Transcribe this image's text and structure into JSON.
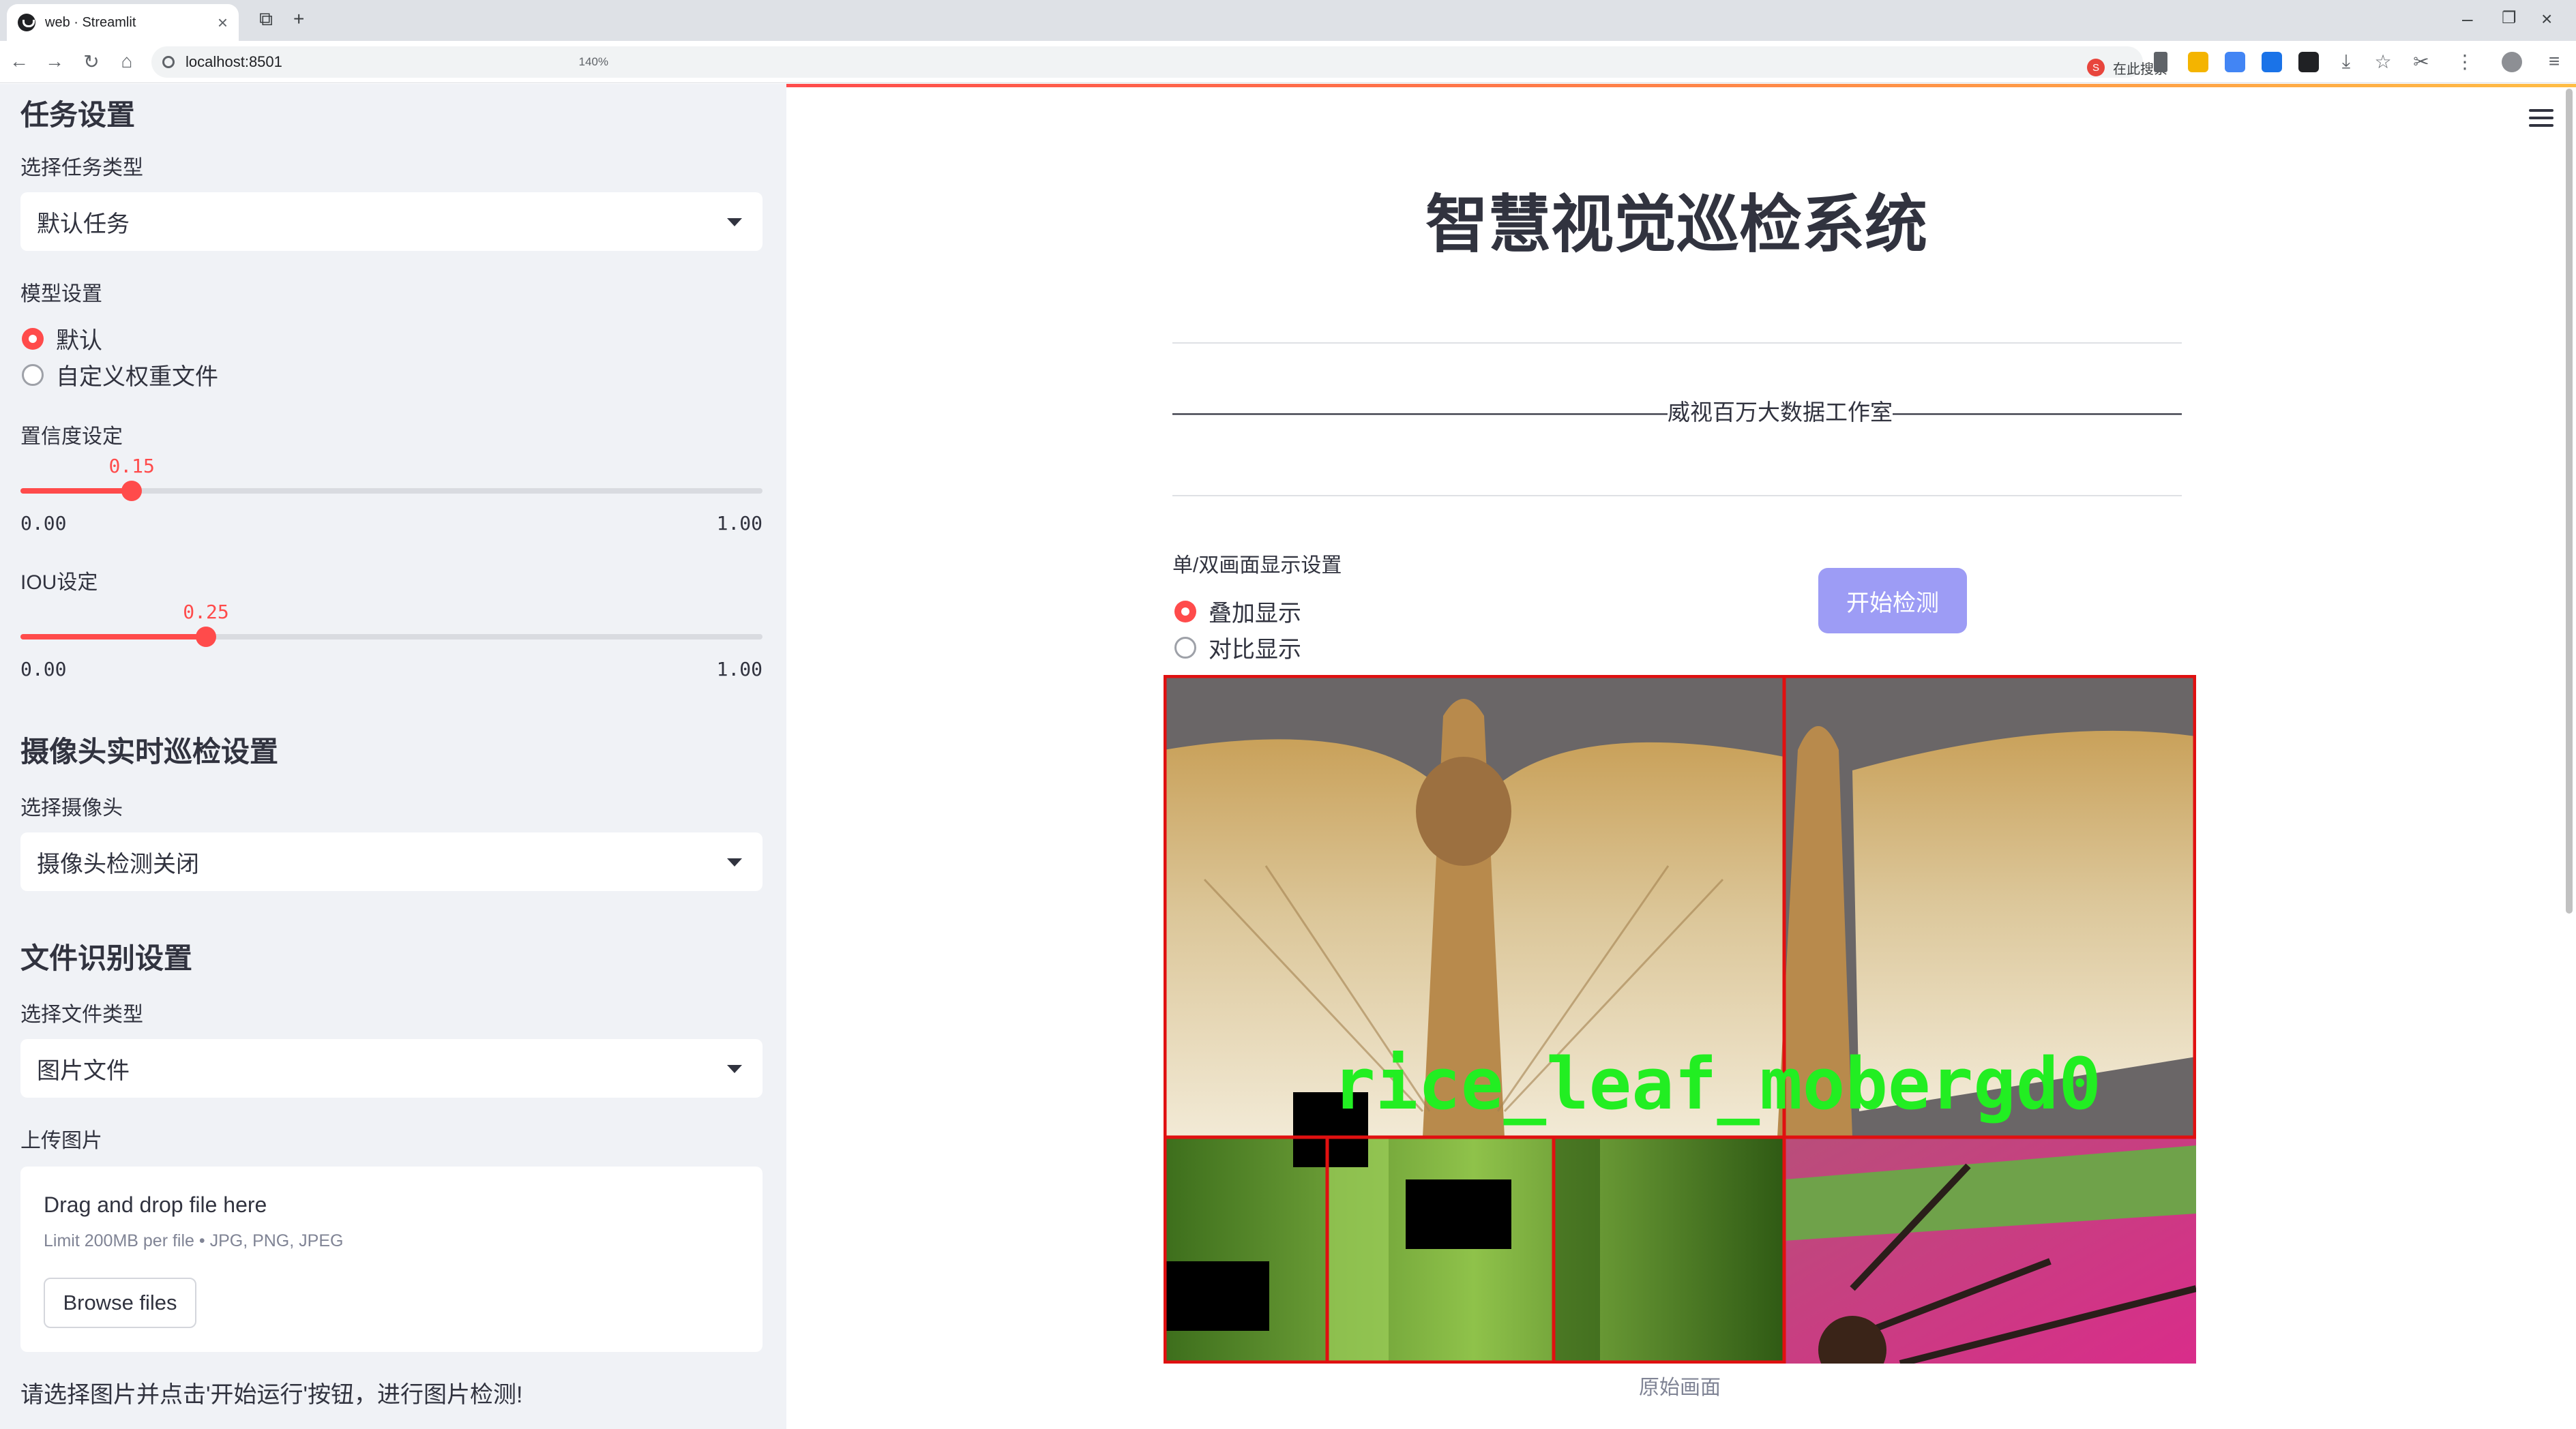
{
  "browser": {
    "tab_title": "web · Streamlit",
    "url": "localhost:8501",
    "zoom": "140%",
    "search_label": "在此搜索"
  },
  "sidebar": {
    "task_section_title": "任务设置",
    "task_type_label": "选择任务类型",
    "task_type_value": "默认任务",
    "model_label": "模型设置",
    "model_options": [
      "默认",
      "自定义权重文件"
    ],
    "model_selected": "默认",
    "confidence": {
      "label": "置信度设定",
      "value": "0.15",
      "min": "0.00",
      "max": "1.00",
      "fraction": 0.15
    },
    "iou": {
      "label": "IOU设定",
      "value": "0.25",
      "min": "0.00",
      "max": "1.00",
      "fraction": 0.25
    },
    "camera_section_title": "摄像头实时巡检设置",
    "camera_label": "选择摄像头",
    "camera_value": "摄像头检测关闭",
    "file_section_title": "文件识别设置",
    "file_type_label": "选择文件类型",
    "file_type_value": "图片文件",
    "upload_label": "上传图片",
    "dropzone_title": "Drag and drop file here",
    "dropzone_limit": "Limit 200MB per file • JPG, PNG, JPEG",
    "browse_label": "Browse files",
    "note": "请选择图片并点击'开始运行'按钮，进行图片检测!"
  },
  "main": {
    "title": "智慧视觉巡检系统",
    "subtitle": "——————————————————————威视百万大数据工作室———————————————————————",
    "display_label": "单/双画面显示设置",
    "display_options": [
      "叠加显示",
      "对比显示"
    ],
    "display_selected": "叠加显示",
    "start_button": "开始检测",
    "detection_label": "rice_leaf_mobergd0",
    "image_caption": "原始画面"
  },
  "colors": {
    "accent": "#ff4b4b",
    "sidebar_bg": "#f0f2f6",
    "button_bg": "#9d9cf5",
    "detection_box": "#e01010",
    "detection_text": "#22ee22"
  }
}
